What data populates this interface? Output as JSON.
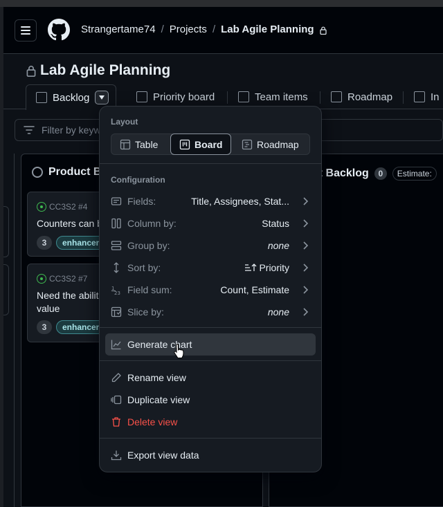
{
  "header": {
    "breadcrumbs": [
      "Strangertame74",
      "Projects",
      "Lab Agile Planning"
    ],
    "separator": "/"
  },
  "page": {
    "title": "Lab Agile Planning"
  },
  "tabs": [
    {
      "label": "Backlog",
      "active": true
    },
    {
      "label": "Priority board"
    },
    {
      "label": "Team items"
    },
    {
      "label": "Roadmap"
    },
    {
      "label": "In"
    }
  ],
  "filter": {
    "placeholder": "Filter by keyw"
  },
  "board": {
    "column1": {
      "title": "Product B",
      "cards": [
        {
          "id": "CC3S2 #4",
          "title": "Counters can b",
          "count": "3",
          "label": "enhancem"
        },
        {
          "id": "CC3S2 #7",
          "title_line1": "Need the abilit",
          "title_line2": "value",
          "count": "3",
          "label": "enhancem"
        }
      ]
    },
    "column2": {
      "title": "nt Backlog",
      "count": "0",
      "estimate": "Estimate:"
    }
  },
  "menu": {
    "layout_heading": "Layout",
    "layout_options": [
      "Table",
      "Board",
      "Roadmap"
    ],
    "layout_active": "Board",
    "config_heading": "Configuration",
    "config": [
      {
        "icon": "fields-icon",
        "label": "Fields:",
        "value": "Title, Assignees, Stat..."
      },
      {
        "icon": "column-icon",
        "label": "Column by:",
        "value": "Status"
      },
      {
        "icon": "group-icon",
        "label": "Group by:",
        "value": "none"
      },
      {
        "icon": "sort-icon",
        "label": "Sort by:",
        "value": "Priority"
      },
      {
        "icon": "sum-icon",
        "label": "Field sum:",
        "value": "Count, Estimate"
      },
      {
        "icon": "slice-icon",
        "label": "Slice by:",
        "value": "none"
      }
    ],
    "actions": {
      "generate_chart": "Generate chart",
      "rename": "Rename view",
      "duplicate": "Duplicate view",
      "delete": "Delete view",
      "export": "Export view data"
    }
  },
  "colors": {
    "background": "#0d1117",
    "danger": "#f85149",
    "success": "#3fb950",
    "label_bg": "#1b3a3f"
  }
}
